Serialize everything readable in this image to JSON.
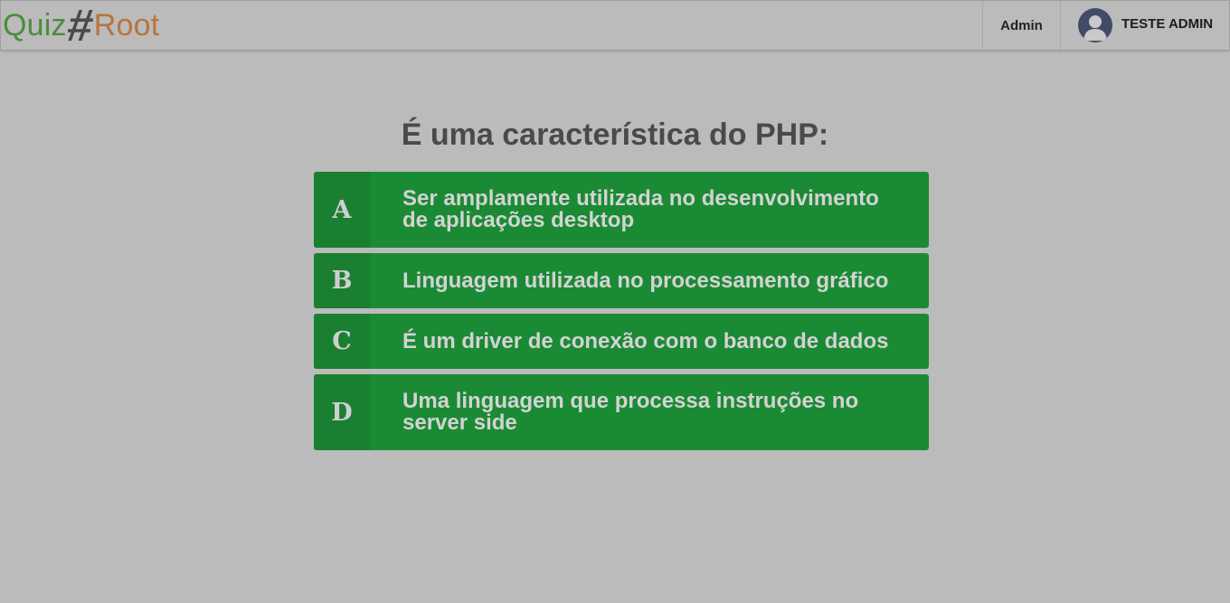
{
  "brand": {
    "part1": "Quiz",
    "part2": "#",
    "part3": "Root"
  },
  "nav": {
    "admin_label": "Admin",
    "user_name": "TESTE ADMIN",
    "avatar_icon": "user-avatar-icon"
  },
  "question": "É uma característica do PHP:",
  "answers": [
    {
      "letter": "A",
      "text": "Ser amplamente utilizada no desenvolvimento de aplicações desktop"
    },
    {
      "letter": "B",
      "text": "Linguagem utilizada no processamento gráfico"
    },
    {
      "letter": "C",
      "text": "É um driver de conexão com o banco de dados"
    },
    {
      "letter": "D",
      "text": "Uma linguagem que processa instruções no server side"
    }
  ],
  "colors": {
    "page_background": "#bbbbbb",
    "answer_green": "#1b8a34",
    "letter_green": "#1a7f30",
    "brand_quiz": "#4b8c3f",
    "brand_root": "#b8743d",
    "avatar_bg": "#404b66"
  }
}
